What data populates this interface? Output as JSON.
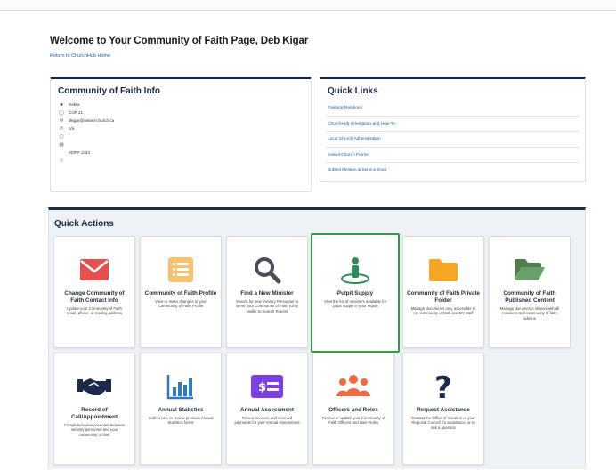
{
  "page": {
    "title": "Welcome to Your Community of Faith Page, Deb Kigar",
    "return_link": "Return to ChurchHub Home"
  },
  "info": {
    "title": "Community of Faith Info",
    "rows": [
      {
        "icon": "person-icon",
        "text": "Debra"
      },
      {
        "icon": "id-icon",
        "text": "COF 21"
      },
      {
        "icon": "email-icon",
        "text": "dkigar@united-church.ca"
      },
      {
        "icon": "phone-icon",
        "text": "n/a"
      },
      {
        "icon": "fax-icon",
        "text": ""
      },
      {
        "icon": "mail-icon",
        "text": ""
      },
      {
        "icon": "address-icon",
        "text": "ADPP 1234"
      },
      {
        "icon": "globe-icon",
        "text": ""
      }
    ]
  },
  "quick_links": {
    "title": "Quick Links",
    "items": [
      "Pastoral Relations",
      "ChurchHub Orientation and How To",
      "Local Church Administration",
      "United Church Forms",
      "Submit Mission & Service Goal"
    ]
  },
  "quick_actions": {
    "title": "Quick Actions",
    "tiles": [
      {
        "name": "change-contact-info",
        "icon": "envelope-icon",
        "color": "#e84f4f",
        "title": "Change Community of Faith Contact Info",
        "desc": "Update your Community of Faith email, phone, or mailing address"
      },
      {
        "name": "community-profile",
        "icon": "list-icon",
        "color": "#f7c26b",
        "title": "Community of Faith Profile",
        "desc": "View or make changes to your Community of Faith Profile"
      },
      {
        "name": "find-minister",
        "icon": "magnifier-icon",
        "color": "#4a4f55",
        "title": "Find a New Minister",
        "desc": "Search for new ministry Personnel to serve your Community of Faith (Only visible to Search Teams)"
      },
      {
        "name": "pulpit-supply",
        "icon": "pulpit-icon",
        "color": "#2e8b57",
        "title": "Pulpit Supply",
        "desc": "View the list of ministers available for pulpit supply in your region"
      },
      {
        "name": "private-folder",
        "icon": "folder-icon",
        "color": "#f5a623",
        "title": "Community of Faith Private Folder",
        "desc": "Manage documents only accessible to my community of faith and DV Staff"
      },
      {
        "name": "published-content",
        "icon": "open-folder-icon",
        "color": "#5a8c5a",
        "title": "Community of Faith Published Content",
        "desc": "Manage documents shared with all ministers and community of faith admins"
      },
      {
        "name": "record-of-call",
        "icon": "handshake-icon",
        "color": "#1b2a4a",
        "title": "Record of Call/Appointment",
        "desc": "Complete/review covenant between ministry personnel and your community of faith"
      },
      {
        "name": "annual-statistics",
        "icon": "bar-chart-icon",
        "color": "#2b7bbd",
        "title": "Annual Statistics",
        "desc": "Submit new or review previous Annual Statistics forms"
      },
      {
        "name": "annual-assessment",
        "icon": "invoice-icon",
        "color": "#7b3fe4",
        "title": "Annual Assessment",
        "desc": "Review invoices and received payments for your Annual Assessment"
      },
      {
        "name": "officers-roles",
        "icon": "people-icon",
        "color": "#f26a3d",
        "title": "Officers and Roles",
        "desc": "Review or update your Community of Faith Officers and User Roles"
      },
      {
        "name": "request-assistance",
        "icon": "question-icon",
        "color": "#1b2a4a",
        "title": "Request Assistance",
        "desc": "Contact the Office of Vocation or your Regional Council for assistance, or to ask a question"
      }
    ]
  }
}
